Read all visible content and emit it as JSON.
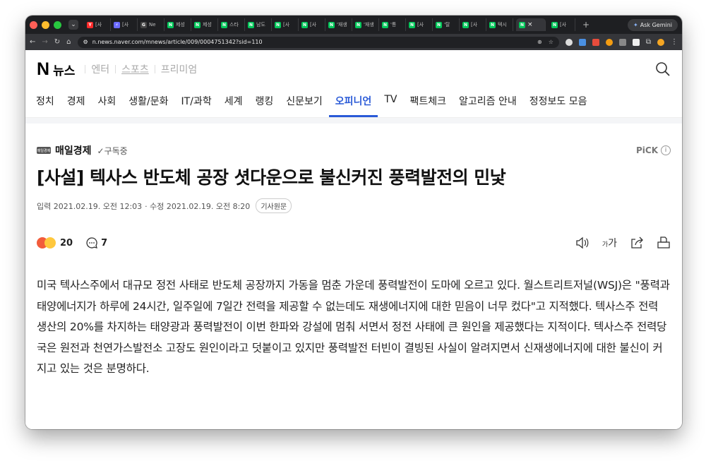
{
  "browser": {
    "tabs": [
      {
        "label": "[사",
        "fav": "Y",
        "color": "#ff2b2b"
      },
      {
        "label": "[사",
        "fav": "⚡",
        "color": "#6b6bff"
      },
      {
        "label": "Ne",
        "fav": "G",
        "color": "#444"
      },
      {
        "label": "제성",
        "fav": "N",
        "color": "#03c75a"
      },
      {
        "label": "제성",
        "fav": "N",
        "color": "#03c75a"
      },
      {
        "label": "스타",
        "fav": "N",
        "color": "#03c75a"
      },
      {
        "label": "남도",
        "fav": "N",
        "color": "#03c75a"
      },
      {
        "label": "[사",
        "fav": "N",
        "color": "#03c75a"
      },
      {
        "label": "[사",
        "fav": "N",
        "color": "#03c75a"
      },
      {
        "label": "'재생",
        "fav": "N",
        "color": "#03c75a"
      },
      {
        "label": "'재생",
        "fav": "N",
        "color": "#03c75a"
      },
      {
        "label": "'통",
        "fav": "N",
        "color": "#03c75a"
      },
      {
        "label": "[사",
        "fav": "N",
        "color": "#03c75a"
      },
      {
        "label": "'탈",
        "fav": "N",
        "color": "#03c75a"
      },
      {
        "label": "[사",
        "fav": "N",
        "color": "#03c75a"
      },
      {
        "label": "텍시",
        "fav": "N",
        "color": "#03c75a"
      }
    ],
    "active_tab_close": "×",
    "after_tab": {
      "label": "[사",
      "fav": "N"
    },
    "new_tab": "+",
    "gemini_label": "Ask Gemini",
    "url": "n.news.naver.com/mnews/article/009/0004751342?sid=110"
  },
  "header": {
    "logo_n": "N",
    "logo_text": "뉴스",
    "services": [
      "엔터",
      "스포츠",
      "프리미엄"
    ]
  },
  "nav": {
    "items": [
      "정치",
      "경제",
      "사회",
      "생활/문화",
      "IT/과학",
      "세계",
      "랭킹",
      "신문보기",
      "오피니언",
      "TV",
      "팩트체크",
      "알고리즘 안내",
      "정정보도 모음"
    ],
    "active_index": 8
  },
  "article": {
    "press_logo_text": "매일경제",
    "press": "매일경제",
    "subscribe": "✓구독중",
    "pick": "PiCK",
    "pick_icon": "i",
    "title": "[사설] 텍사스 반도체 공장 셧다운으로 불신커진 풍력발전의 민낯",
    "date_input": "입력 2021.02.19. 오전 12:03",
    "date_edit": "· 수정 2021.02.19. 오전 8:20",
    "original_btn": "기사원문",
    "reaction_count": "20",
    "comment_count": "7",
    "body": "미국 텍사스주에서 대규모 정전 사태로 반도체 공장까지 가동을 멈춘 가운데 풍력발전이 도마에 오르고 있다. 월스트리트저널(WSJ)은 \"풍력과 태양에너지가 하루에 24시간, 일주일에 7일간 전력을 제공할 수 없는데도 재생에너지에 대한 믿음이 너무 컸다\"고 지적했다. 텍사스주 전력 생산의 20%를 차지하는 태양광과 풍력발전이 이번 한파와 강설에 멈춰 서면서 정전 사태에 큰 원인을 제공했다는 지적이다. 텍사스주 전력당국은 원전과 천연가스발전소 고장도 원인이라고 덧붙이고 있지만 풍력발전 터빈이 결빙된 사실이 알려지면서 신재생에너지에 대한 불신이 커지고 있는 것은 분명하다.",
    "font_size_label": "가"
  }
}
